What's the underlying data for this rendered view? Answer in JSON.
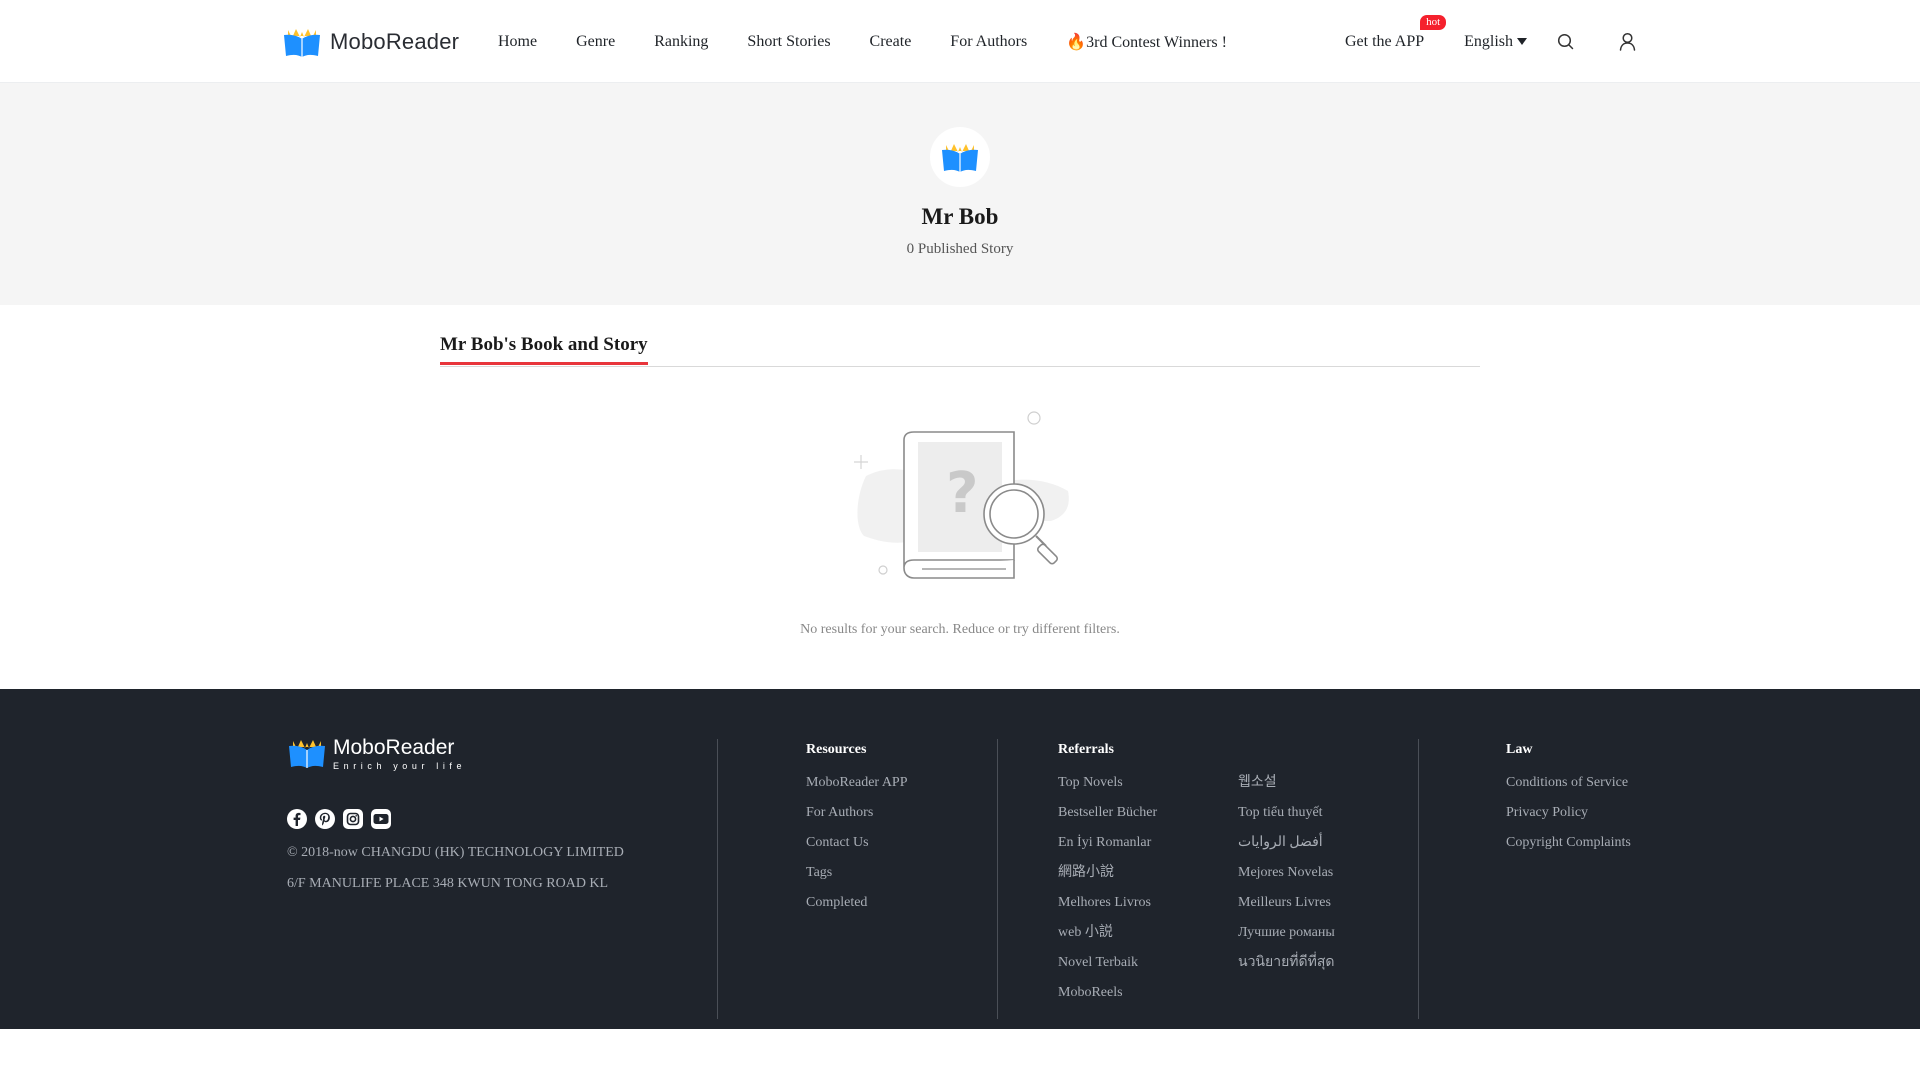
{
  "header": {
    "logo_text": "MoboReader",
    "nav": [
      "Home",
      "Genre",
      "Ranking",
      "Short Stories",
      "Create",
      "For Authors"
    ],
    "contest_icon": "🔥",
    "contest_label": "3rd Contest Winners !",
    "get_app_label": "Get the APP",
    "hot_badge": "hot",
    "language": "English",
    "search_icon": "search-icon",
    "user_icon": "user-icon"
  },
  "profile": {
    "name": "Mr Bob",
    "published": "0 Published Story"
  },
  "section": {
    "title": "Mr Bob's Book and Story",
    "empty_text": "No results for your search. Reduce or try different filters."
  },
  "footer": {
    "logo_text": "MoboReader",
    "tagline": "Enrich your life",
    "socials": [
      "facebook-icon",
      "pinterest-icon",
      "instagram-icon",
      "youtube-icon"
    ],
    "copyright": "© 2018-now CHANGDU (HK) TECHNOLOGY LIMITED",
    "address": "6/F MANULIFE PLACE 348 KWUN TONG ROAD KL",
    "resources": {
      "title": "Resources",
      "items": [
        "MoboReader APP",
        "For Authors",
        "Contact Us",
        "Tags",
        "Completed"
      ]
    },
    "referrals": {
      "title": "Referrals",
      "col1": [
        "Top Novels",
        "Bestseller Bücher",
        "En İyi Romanlar",
        "網路小說",
        "Melhores Livros",
        "web 小説",
        "Novel Terbaik",
        "MoboReels"
      ],
      "col2": [
        "웹소설",
        "Top tiểu thuyết",
        "أفضل الروايات",
        "Mejores Novelas",
        "Meilleurs Livres",
        "Лучшие романы",
        "นวนิยายที่ดีที่สุด"
      ]
    },
    "law": {
      "title": "Law",
      "items": [
        "Conditions of Service",
        "Privacy Policy",
        "Copyright Complaints"
      ]
    }
  },
  "colors": {
    "accent_red": "#e8353b",
    "hot_red": "#f5212d",
    "footer_bg": "#1f242c",
    "banner_bg": "#f5f5f5",
    "logo_blue": "#1e90ff",
    "logo_yellow": "#ffc12b"
  }
}
